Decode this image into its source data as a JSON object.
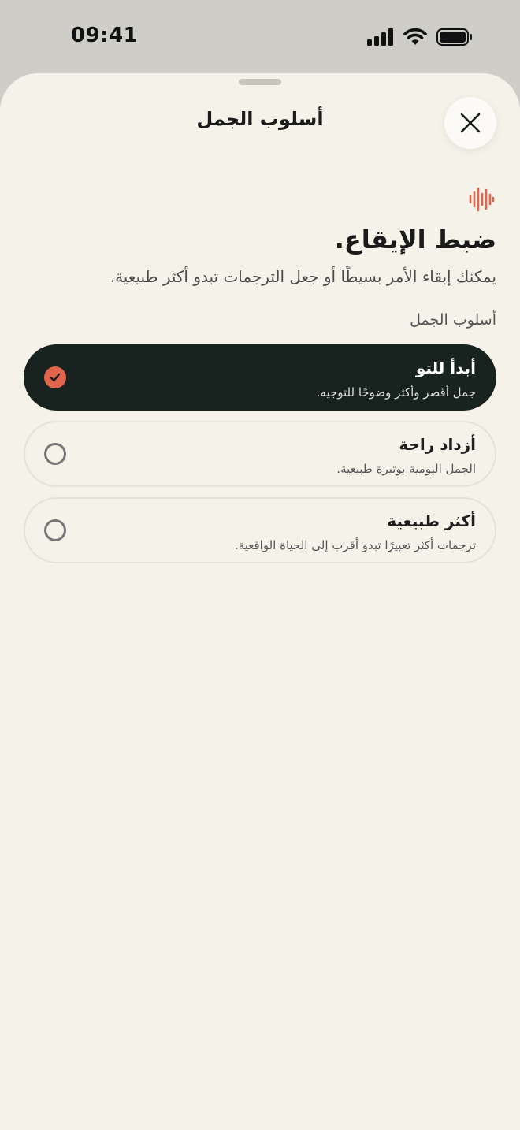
{
  "status_bar": {
    "time": "09:41",
    "icons": [
      "signal-icon",
      "wifi-icon",
      "battery-icon"
    ]
  },
  "sheet": {
    "title": "أسلوب الجمل",
    "close_icon": "close-icon"
  },
  "content": {
    "accent_icon": "sound-wave-icon",
    "heading": "ضبط الإيقاع.",
    "subtitle": "يمكنك إبقاء الأمر بسيطًا أو جعل الترجمات تبدو أكثر طبيعية.",
    "section_label": "أسلوب الجمل"
  },
  "options": [
    {
      "title": "أبدأ للتو",
      "description": "جمل أقصر وأكثر وضوحًا للتوجيه.",
      "selected": true
    },
    {
      "title": "أزداد راحة",
      "description": "الجمل اليومية بوتيرة طبيعية.",
      "selected": false
    },
    {
      "title": "أكثر طبيعية",
      "description": "ترجمات أكثر تعبيرًا تبدو أقرب إلى الحياة الواقعية.",
      "selected": false
    }
  ],
  "colors": {
    "accent": "#e0654c",
    "selected_background": "#182320",
    "sheet_background": "#f5f2ea"
  }
}
